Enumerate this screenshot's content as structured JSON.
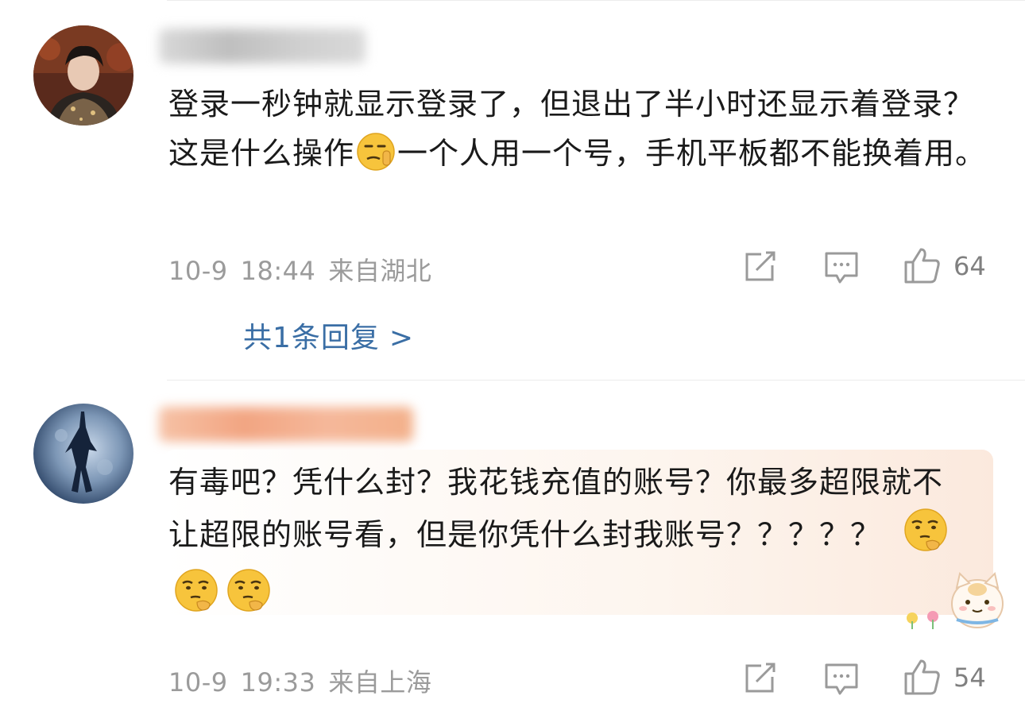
{
  "comments": [
    {
      "text_part1": "登录一秒钟就显示登录了，但退出了半小时还显示着登录？这是什么操作",
      "emoji1": "shh-face-emoji",
      "text_part2": "一个人用一个号，手机平板都不能换着用。",
      "date": "10-9",
      "time": "18:44",
      "location": "来自湖北",
      "likes": "64",
      "reply_link": "共1条回复",
      "reply_arrow": ">"
    },
    {
      "text_part1": "有毒吧？凭什么封？我花钱充值的账号？你最多超限就不让超限的账号看，但是你凭什么封我账号？？？？？",
      "emojis": [
        "thinking-face-emoji",
        "thinking-face-emoji",
        "thinking-face-emoji"
      ],
      "date": "10-9",
      "time": "19:33",
      "location": "来自上海",
      "likes": "54"
    }
  ],
  "colors": {
    "reply_link": "#3a6ea5",
    "meta_text": "#9b9b9b",
    "icon_gray": "#9a9a9a",
    "highlight_bg": "#fbe9dd"
  }
}
